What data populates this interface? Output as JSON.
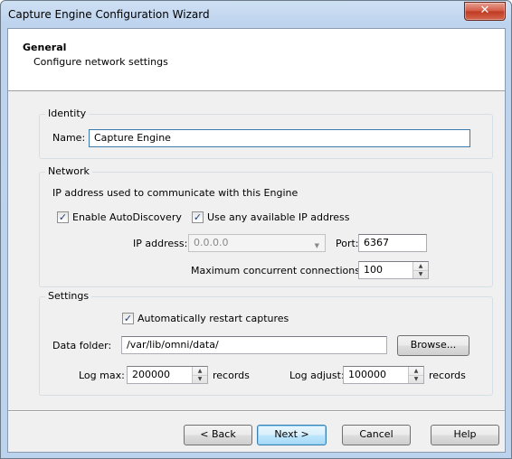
{
  "window": {
    "title": "Capture Engine Configuration Wizard",
    "close_glyph": "✕"
  },
  "header": {
    "title": "General",
    "subtitle": "Configure network settings"
  },
  "identity": {
    "group_label": "Identity",
    "name_label": "Name:",
    "name_value": "Capture Engine"
  },
  "network": {
    "group_label": "Network",
    "description": "IP address used to communicate with this Engine",
    "enable_autodiscovery": {
      "label": "Enable AutoDiscovery",
      "checked": true
    },
    "use_any_ip": {
      "label": "Use any available IP address",
      "checked": true
    },
    "ip_label": "IP address:",
    "ip_value": "0.0.0.0",
    "port_label": "Port:",
    "port_value": "6367",
    "max_conn_label": "Maximum concurrent connections:",
    "max_conn_value": "100"
  },
  "settings": {
    "group_label": "Settings",
    "auto_restart": {
      "label": "Automatically restart captures",
      "checked": true
    },
    "data_folder_label": "Data folder:",
    "data_folder_value": "/var/lib/omni/data/",
    "browse_label": "Browse...",
    "log_max_label": "Log max:",
    "log_max_value": "200000",
    "log_max_unit": "records",
    "log_adjust_label": "Log adjust:",
    "log_adjust_value": "100000",
    "log_adjust_unit": "records"
  },
  "footer": {
    "back_label": "< Back",
    "next_label": "Next >",
    "cancel_label": "Cancel",
    "help_label": "Help"
  },
  "glyphs": {
    "check": "✓",
    "dropdown": "▼",
    "spin_up": "▲",
    "spin_down": "▼"
  },
  "colors": {
    "title_bar": "#bdd3ee",
    "close_button": "#c8432c",
    "default_button_border": "#3c7fb1"
  }
}
